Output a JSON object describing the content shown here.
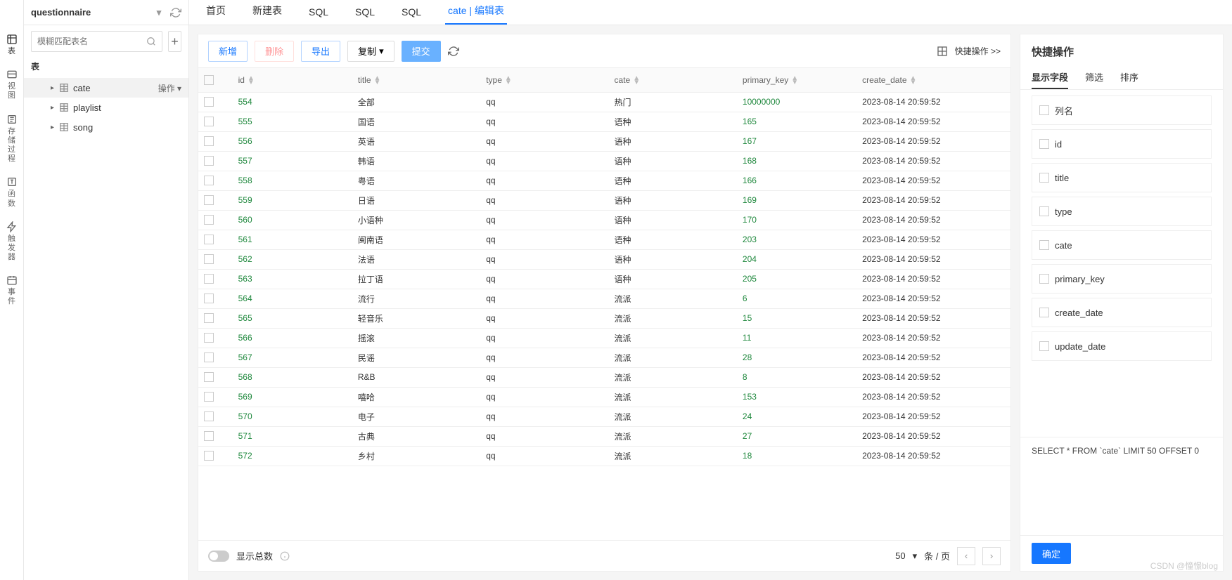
{
  "sidebar": {
    "db_name": "questionnaire",
    "search_placeholder": "模糊匹配表名",
    "current_section": "表",
    "action_label": "操作",
    "tables": [
      {
        "name": "cate",
        "selected": true
      },
      {
        "name": "playlist",
        "selected": false
      },
      {
        "name": "song",
        "selected": false
      }
    ]
  },
  "rail": [
    {
      "key": "table",
      "label": "表"
    },
    {
      "key": "view",
      "label": "视图"
    },
    {
      "key": "proc",
      "label": "存储过程"
    },
    {
      "key": "func",
      "label": "函数"
    },
    {
      "key": "trig",
      "label": "触发器"
    },
    {
      "key": "event",
      "label": "事件"
    }
  ],
  "tabs": [
    {
      "label": "首页"
    },
    {
      "label": "新建表"
    },
    {
      "label": "SQL"
    },
    {
      "label": "SQL"
    },
    {
      "label": "SQL"
    },
    {
      "label": "cate | 编辑表",
      "active": true
    }
  ],
  "toolbar": {
    "new": "新增",
    "delete": "删除",
    "export": "导出",
    "copy": "复制",
    "submit": "提交",
    "quick_ops": "快捷操作 >>"
  },
  "columns": [
    "id",
    "title",
    "type",
    "cate",
    "primary_key",
    "create_date"
  ],
  "rows": [
    {
      "id": 554,
      "title": "全部",
      "type": "qq",
      "cate": "热门",
      "primary_key": "10000000",
      "create_date": "2023-08-14 20:59:52"
    },
    {
      "id": 555,
      "title": "国语",
      "type": "qq",
      "cate": "语种",
      "primary_key": "165",
      "create_date": "2023-08-14 20:59:52"
    },
    {
      "id": 556,
      "title": "英语",
      "type": "qq",
      "cate": "语种",
      "primary_key": "167",
      "create_date": "2023-08-14 20:59:52"
    },
    {
      "id": 557,
      "title": "韩语",
      "type": "qq",
      "cate": "语种",
      "primary_key": "168",
      "create_date": "2023-08-14 20:59:52"
    },
    {
      "id": 558,
      "title": "粤语",
      "type": "qq",
      "cate": "语种",
      "primary_key": "166",
      "create_date": "2023-08-14 20:59:52"
    },
    {
      "id": 559,
      "title": "日语",
      "type": "qq",
      "cate": "语种",
      "primary_key": "169",
      "create_date": "2023-08-14 20:59:52"
    },
    {
      "id": 560,
      "title": "小语种",
      "type": "qq",
      "cate": "语种",
      "primary_key": "170",
      "create_date": "2023-08-14 20:59:52"
    },
    {
      "id": 561,
      "title": "闽南语",
      "type": "qq",
      "cate": "语种",
      "primary_key": "203",
      "create_date": "2023-08-14 20:59:52"
    },
    {
      "id": 562,
      "title": "法语",
      "type": "qq",
      "cate": "语种",
      "primary_key": "204",
      "create_date": "2023-08-14 20:59:52"
    },
    {
      "id": 563,
      "title": "拉丁语",
      "type": "qq",
      "cate": "语种",
      "primary_key": "205",
      "create_date": "2023-08-14 20:59:52"
    },
    {
      "id": 564,
      "title": "流行",
      "type": "qq",
      "cate": "流派",
      "primary_key": "6",
      "create_date": "2023-08-14 20:59:52"
    },
    {
      "id": 565,
      "title": "轻音乐",
      "type": "qq",
      "cate": "流派",
      "primary_key": "15",
      "create_date": "2023-08-14 20:59:52"
    },
    {
      "id": 566,
      "title": "摇滚",
      "type": "qq",
      "cate": "流派",
      "primary_key": "11",
      "create_date": "2023-08-14 20:59:52"
    },
    {
      "id": 567,
      "title": "民谣",
      "type": "qq",
      "cate": "流派",
      "primary_key": "28",
      "create_date": "2023-08-14 20:59:52"
    },
    {
      "id": 568,
      "title": "R&#38;B",
      "type": "qq",
      "cate": "流派",
      "primary_key": "8",
      "create_date": "2023-08-14 20:59:52"
    },
    {
      "id": 569,
      "title": "嘻哈",
      "type": "qq",
      "cate": "流派",
      "primary_key": "153",
      "create_date": "2023-08-14 20:59:52"
    },
    {
      "id": 570,
      "title": "电子",
      "type": "qq",
      "cate": "流派",
      "primary_key": "24",
      "create_date": "2023-08-14 20:59:52"
    },
    {
      "id": 571,
      "title": "古典",
      "type": "qq",
      "cate": "流派",
      "primary_key": "27",
      "create_date": "2023-08-14 20:59:52"
    },
    {
      "id": 572,
      "title": "乡村",
      "type": "qq",
      "cate": "流派",
      "primary_key": "18",
      "create_date": "2023-08-14 20:59:52"
    }
  ],
  "footer": {
    "show_total": "显示总数",
    "page_size": "50",
    "per_page": "条 / 页"
  },
  "right_panel": {
    "title": "快捷操作",
    "tabs": [
      "显示字段",
      "筛选",
      "排序"
    ],
    "field_header": "列名",
    "fields": [
      "id",
      "title",
      "type",
      "cate",
      "primary_key",
      "create_date",
      "update_date"
    ],
    "sql": "SELECT * FROM `cate` LIMIT 50 OFFSET 0",
    "ok": "确定"
  },
  "watermark": "CSDN @憧憬blog"
}
